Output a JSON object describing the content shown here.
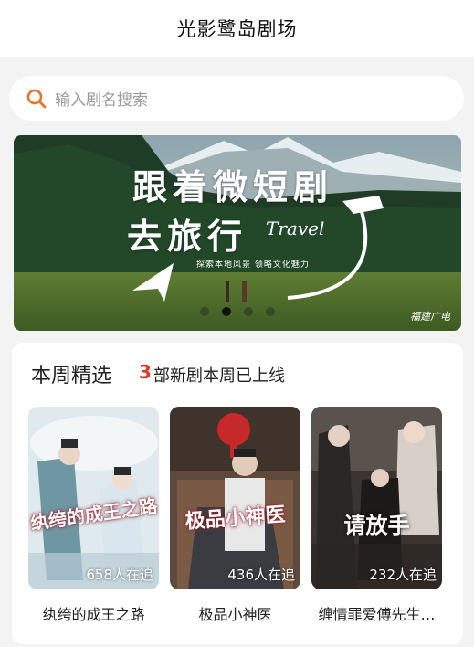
{
  "header": {
    "title": "光影鹭岛剧场"
  },
  "search": {
    "placeholder": "输入剧名搜索",
    "icon": "search-icon"
  },
  "banner": {
    "line1": "跟着微短剧",
    "line2": "去旅行",
    "travel": "Travel",
    "subtitle": "探索本地风景 领略文化魅力",
    "watermark": "福建广电",
    "dots": 4,
    "active_dot": 2
  },
  "weekly": {
    "title": "本周精选",
    "count": "3",
    "subtitle": "部新剧本周已上线",
    "items": [
      {
        "title": "纨绔的成王之路",
        "follow": "658人在追",
        "poster_title": "纨绔的成王之路"
      },
      {
        "title": "极品小神医",
        "follow": "436人在追",
        "poster_title": "极品小神医"
      },
      {
        "title": "缠情罪爱傅先生…",
        "follow": "232人在追",
        "poster_title": "请放手"
      }
    ]
  },
  "colors": {
    "accent": "#e8732c",
    "count_red": "#e03a2e"
  }
}
